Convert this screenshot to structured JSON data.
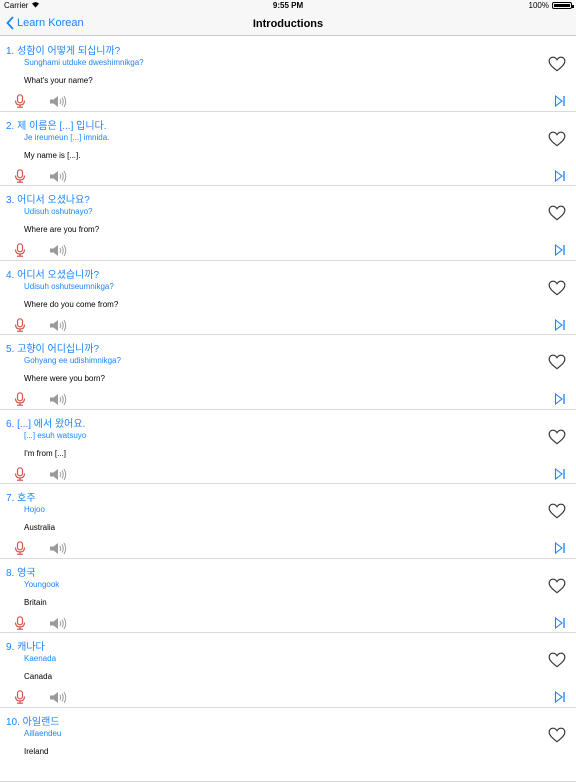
{
  "status_bar": {
    "carrier": "Carrier",
    "time": "9:55 PM",
    "battery": "100%"
  },
  "nav": {
    "back_label": "Learn Korean",
    "title": "Introductions"
  },
  "colors": {
    "accent": "#1a84ff",
    "mic": "#d9534f",
    "speaker": "#9a9a9a"
  },
  "phrases": [
    {
      "korean": "1. 성함이 어떻게 되십니까?",
      "romanization": "Sunghami utduke dweshimnikga?",
      "english": "What's your name?"
    },
    {
      "korean": "2. 제 이름은 [...] 입니다.",
      "romanization": "Je ireumeun [...] imnida.",
      "english": "My name is [...]."
    },
    {
      "korean": "3. 어디서 오셨나요?",
      "romanization": "Udisuh oshutnayo?",
      "english": "Where are you from?"
    },
    {
      "korean": "4. 어디서 오셨습니까?",
      "romanization": "Udisuh oshutseumnikga?",
      "english": "Where do you come from?"
    },
    {
      "korean": "5. 고향이 어디십니까?",
      "romanization": "Gohyang ee udishimnikga?",
      "english": "Where were you born?"
    },
    {
      "korean": "6. [...] 에서 왔어요.",
      "romanization": "[...] esuh watsuyo",
      "english": "I'm from [...]"
    },
    {
      "korean": "7. 호주",
      "romanization": "Hojoo",
      "english": "Australia"
    },
    {
      "korean": "8. 영국",
      "romanization": "Youngook",
      "english": "Britain"
    },
    {
      "korean": "9. 캐나다",
      "romanization": "Kaenada",
      "english": "Canada"
    },
    {
      "korean": "10. 아일랜드",
      "romanization": "Aillaendeu",
      "english": "Ireland"
    }
  ]
}
